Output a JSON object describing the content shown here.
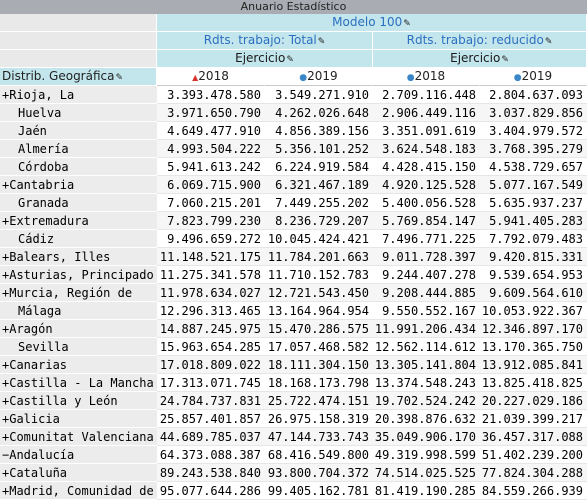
{
  "title": "Anuario Estadístico",
  "measure_group": "Modelo 100",
  "measures": [
    "Rdts. trabajo: Total",
    "Rdts. trabajo: reducido"
  ],
  "dimension_level": "Ejercicio",
  "dimension_row_header": "Distrib. Geográfica",
  "years": [
    "2018",
    "2019",
    "2018",
    "2019"
  ],
  "rows": [
    {
      "label": "+Rioja, La",
      "indent": false,
      "values": [
        "3.393.478.580",
        "3.549.271.910",
        "2.709.116.448",
        "2.804.637.093"
      ]
    },
    {
      "label": "Huelva",
      "indent": true,
      "values": [
        "3.971.650.790",
        "4.262.026.648",
        "2.906.449.116",
        "3.037.829.856"
      ]
    },
    {
      "label": "Jaén",
      "indent": true,
      "values": [
        "4.649.477.910",
        "4.856.389.156",
        "3.351.091.619",
        "3.404.979.572"
      ]
    },
    {
      "label": "Almería",
      "indent": true,
      "values": [
        "4.993.504.222",
        "5.356.101.252",
        "3.624.548.183",
        "3.768.395.279"
      ]
    },
    {
      "label": "Córdoba",
      "indent": true,
      "values": [
        "5.941.613.242",
        "6.224.919.584",
        "4.428.415.150",
        "4.538.729.657"
      ]
    },
    {
      "label": "+Cantabria",
      "indent": false,
      "values": [
        "6.069.715.900",
        "6.321.467.189",
        "4.920.125.528",
        "5.077.167.549"
      ]
    },
    {
      "label": "Granada",
      "indent": true,
      "values": [
        "7.060.215.201",
        "7.449.255.202",
        "5.400.056.528",
        "5.635.937.237"
      ]
    },
    {
      "label": "+Extremadura",
      "indent": false,
      "values": [
        "7.823.799.230",
        "8.236.729.207",
        "5.769.854.147",
        "5.941.405.283"
      ]
    },
    {
      "label": "Cádiz",
      "indent": true,
      "values": [
        "9.496.659.272",
        "10.045.424.421",
        "7.496.771.225",
        "7.792.079.483"
      ]
    },
    {
      "label": "+Balears, Illes",
      "indent": false,
      "values": [
        "11.148.521.175",
        "11.784.201.663",
        "9.011.728.397",
        "9.420.815.331"
      ]
    },
    {
      "label": "+Asturias, Principado de",
      "indent": false,
      "values": [
        "11.275.341.578",
        "11.710.152.783",
        "9.244.407.278",
        "9.539.654.953"
      ]
    },
    {
      "label": "+Murcia, Región de",
      "indent": false,
      "values": [
        "11.978.634.027",
        "12.721.543.450",
        "9.208.444.885",
        "9.609.564.610"
      ]
    },
    {
      "label": "Málaga",
      "indent": true,
      "values": [
        "12.296.313.465",
        "13.164.964.954",
        "9.550.552.167",
        "10.053.922.367"
      ]
    },
    {
      "label": "+Aragón",
      "indent": false,
      "values": [
        "14.887.245.975",
        "15.470.286.575",
        "11.991.206.434",
        "12.346.897.170"
      ]
    },
    {
      "label": "Sevilla",
      "indent": true,
      "values": [
        "15.963.654.285",
        "17.057.468.582",
        "12.562.114.612",
        "13.170.365.750"
      ]
    },
    {
      "label": "+Canarias",
      "indent": false,
      "values": [
        "17.018.809.022",
        "18.111.304.150",
        "13.305.141.804",
        "13.912.085.841"
      ]
    },
    {
      "label": "+Castilla - La Mancha",
      "indent": false,
      "values": [
        "17.313.071.745",
        "18.168.173.798",
        "13.374.548.243",
        "13.825.418.825"
      ]
    },
    {
      "label": "+Castilla y León",
      "indent": false,
      "values": [
        "24.784.737.831",
        "25.722.474.151",
        "19.702.524.242",
        "20.227.029.186"
      ]
    },
    {
      "label": "+Galicia",
      "indent": false,
      "values": [
        "25.857.401.857",
        "26.975.158.319",
        "20.398.876.632",
        "21.039.399.217"
      ]
    },
    {
      "label": "+Comunitat Valenciana",
      "indent": false,
      "values": [
        "44.689.785.037",
        "47.144.733.743",
        "35.049.906.170",
        "36.457.317.088"
      ]
    },
    {
      "label": "−Andalucía",
      "indent": false,
      "values": [
        "64.373.088.387",
        "68.416.549.800",
        "49.319.998.599",
        "51.402.239.200"
      ]
    },
    {
      "label": "+Cataluña",
      "indent": false,
      "values": [
        "89.243.538.840",
        "93.800.704.372",
        "74.514.025.525",
        "77.824.304.288"
      ]
    },
    {
      "label": "+Madrid, Comunidad de",
      "indent": false,
      "values": [
        "95.077.644.286",
        "99.405.162.781",
        "81.419.190.285",
        "84.559.266.939"
      ]
    }
  ]
}
